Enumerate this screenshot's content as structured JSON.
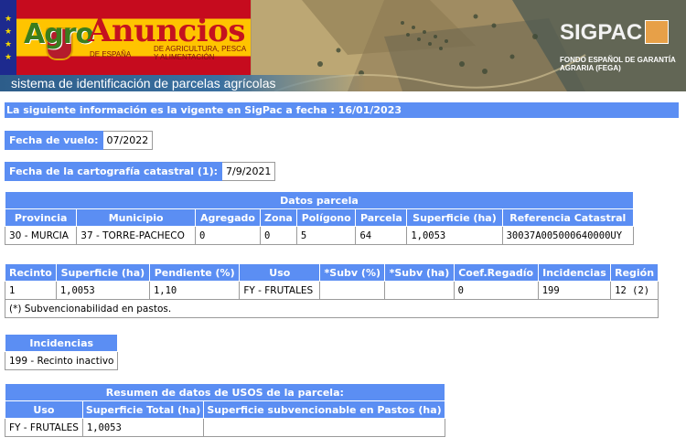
{
  "banner": {
    "logo_agro": "Agro",
    "logo_anuncios": "Anuncios",
    "logo_sub_left": "DE ESPAÑA",
    "logo_sub_right": "DE AGRICULTURA, PESCA Y ALIMENTACIÓN",
    "tagline": "sistema de identificación de parcelas agrícolas",
    "sigpac_logo": "SIGPAC",
    "fega_text": "FONDO ESPAÑOL DE GARANTÍA AGRARIA (FEGA)"
  },
  "info_bar": "La siguiente información es la vigente en SigPac a fecha : 16/01/2023",
  "fecha_vuelo": {
    "label": "Fecha de vuelo:",
    "value": "07/2022"
  },
  "fecha_cartografia": {
    "label": "Fecha de la cartografía catastral (1):",
    "value": "7/9/2021"
  },
  "datos_parcela": {
    "title": "Datos parcela",
    "headers": [
      "Provincia",
      "Municipio",
      "Agregado",
      "Zona",
      "Polígono",
      "Parcela",
      "Superficie (ha)",
      "Referencia Catastral"
    ],
    "row": [
      "30 - MURCIA",
      "37 - TORRE-PACHECO",
      "0",
      "0",
      "5",
      "64",
      "1,0053",
      "30037A005000640000UY"
    ]
  },
  "recinto": {
    "headers": [
      "Recinto",
      "Superficie (ha)",
      "Pendiente (%)",
      "Uso",
      "*Subv (%)",
      "*Subv (ha)",
      "Coef.Regadío",
      "Incidencias",
      "Región"
    ],
    "row": [
      "1",
      "1,0053",
      "1,10",
      "FY - FRUTALES",
      "",
      "",
      "0",
      "199",
      "12 (2)"
    ],
    "note": "(*) Subvencionabilidad en pastos."
  },
  "incidencias": {
    "title": "Incidencias",
    "value": "199 - Recinto inactivo"
  },
  "resumen": {
    "title": "Resumen de datos de USOS de la parcela:",
    "headers": [
      "Uso",
      "Superficie Total (ha)",
      "Superficie subvencionable en Pastos (ha)"
    ],
    "row": [
      "FY - FRUTALES",
      "1,0053",
      ""
    ]
  },
  "colors": {
    "header_blue": "#5b8ef3",
    "border_gray": "#9a9a9a"
  }
}
